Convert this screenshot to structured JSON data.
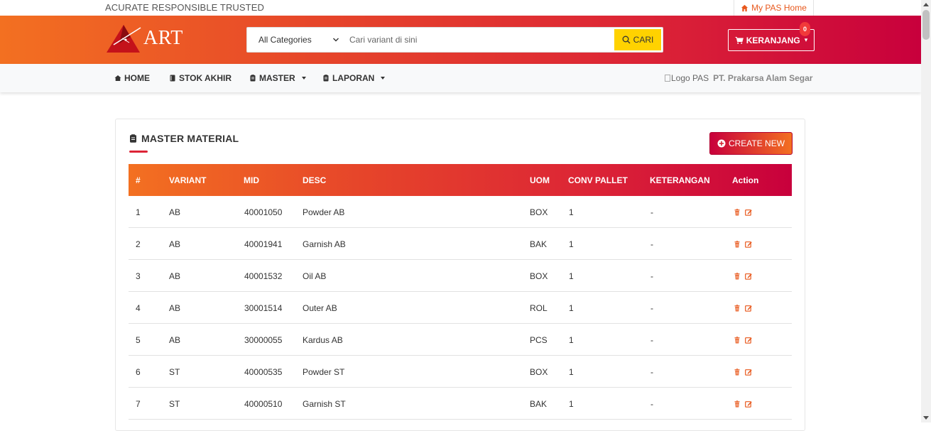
{
  "topbar": {
    "tagline": "ACURATE RESPONSIBLE TRUSTED",
    "home_link": "My PAS Home"
  },
  "header": {
    "logo_text": "ART",
    "search": {
      "category": "All Categories",
      "placeholder": "Cari variant di sini",
      "button_label": "CARI"
    },
    "cart": {
      "label": "KERANJANG",
      "count": "0"
    }
  },
  "nav": {
    "items": [
      {
        "label": "HOME"
      },
      {
        "label": "STOK AKHIR"
      },
      {
        "label": "MASTER"
      },
      {
        "label": "LAPORAN"
      }
    ],
    "company_logo_alt": "Logo PAS",
    "company_name": "PT. Prakarsa Alam Segar"
  },
  "card": {
    "title": "MASTER MATERIAL",
    "create_label": "CREATE NEW"
  },
  "table": {
    "headers": [
      "#",
      "VARIANT",
      "MID",
      "DESC",
      "UOM",
      "CONV PALLET",
      "KETERANGAN",
      "Action"
    ],
    "rows": [
      {
        "no": "1",
        "variant": "AB",
        "mid": "40001050",
        "desc": "Powder AB",
        "uom": "BOX",
        "conv": "1",
        "ket": "-"
      },
      {
        "no": "2",
        "variant": "AB",
        "mid": "40001941",
        "desc": "Garnish AB",
        "uom": "BAK",
        "conv": "1",
        "ket": "-"
      },
      {
        "no": "3",
        "variant": "AB",
        "mid": "40001532",
        "desc": "Oil AB",
        "uom": "BOX",
        "conv": "1",
        "ket": "-"
      },
      {
        "no": "4",
        "variant": "AB",
        "mid": "30001514",
        "desc": "Outer AB",
        "uom": "ROL",
        "conv": "1",
        "ket": "-"
      },
      {
        "no": "5",
        "variant": "AB",
        "mid": "30000055",
        "desc": "Kardus AB",
        "uom": "PCS",
        "conv": "1",
        "ket": "-"
      },
      {
        "no": "6",
        "variant": "ST",
        "mid": "40000535",
        "desc": "Powder ST",
        "uom": "BOX",
        "conv": "1",
        "ket": "-"
      },
      {
        "no": "7",
        "variant": "ST",
        "mid": "40000510",
        "desc": "Garnish ST",
        "uom": "BAK",
        "conv": "1",
        "ket": "-"
      }
    ]
  },
  "colors": {
    "brand_orange": "#f37021",
    "brand_red": "#c8003c",
    "search_button": "#ffd200",
    "action_icon": "#e8581c"
  },
  "icons": {
    "home_link": "home-icon",
    "search": "search-icon",
    "cart": "cart-icon",
    "nav_home": "home-icon",
    "nav_stok": "book-icon",
    "nav_master": "clipboard-icon",
    "nav_laporan": "clipboard-icon",
    "title": "clipboard-icon",
    "create": "plus-circle-icon",
    "delete": "trash-icon",
    "edit": "edit-icon"
  }
}
